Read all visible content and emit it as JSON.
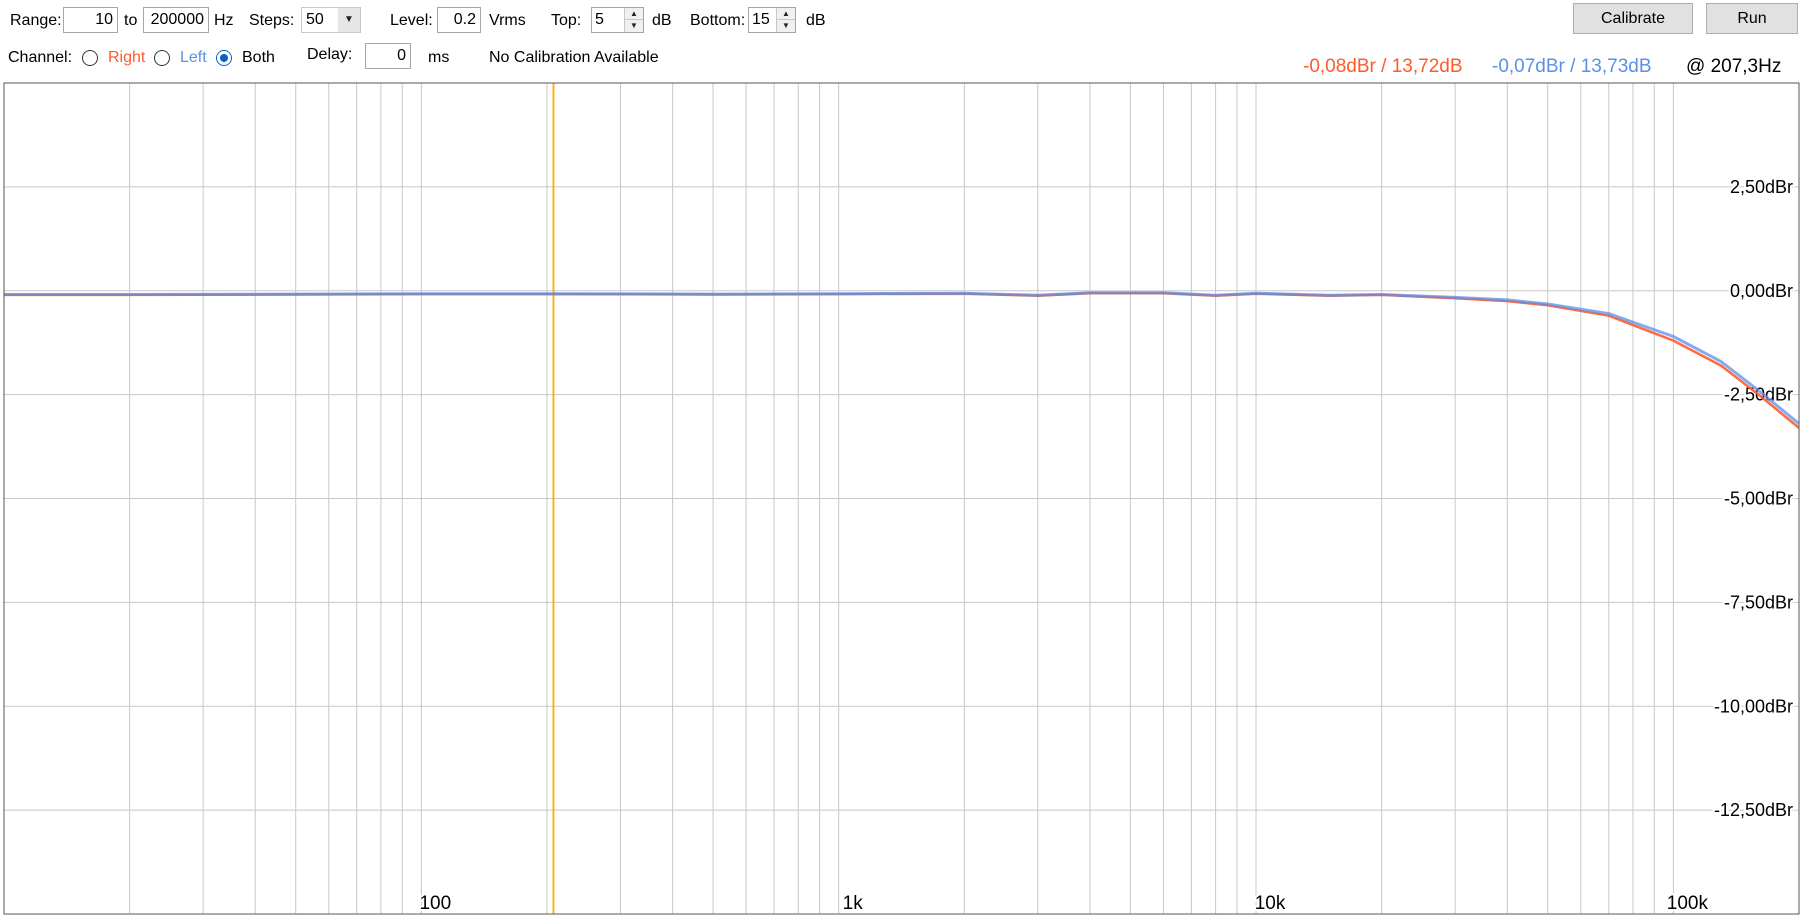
{
  "toolbar": {
    "range_label": "Range:",
    "range_from": "10",
    "range_to_label": "to",
    "range_to": "200000",
    "hz_label": "Hz",
    "steps_label": "Steps:",
    "steps_value": "50",
    "level_label": "Level:",
    "level_value": "0.2",
    "vrms_label": "Vrms",
    "top_label": "Top:",
    "top_value": "5",
    "top_unit": "dB",
    "bottom_label": "Bottom:",
    "bottom_value": "15",
    "bottom_unit": "dB",
    "channel_label": "Channel:",
    "channel_options": [
      "Right",
      "Left",
      "Both"
    ],
    "channel_selected": "Both",
    "delay_label": "Delay:",
    "delay_value": "0",
    "delay_unit": "ms",
    "calibration_status": "No Calibration Available",
    "calibrate_button": "Calibrate",
    "run_button": "Run"
  },
  "readout": {
    "right": "-0,08dBr / 13,72dB",
    "left": "-0,07dBr / 13,73dB",
    "freq": "@ 207,3Hz"
  },
  "colors": {
    "right": "#ff5a2a",
    "left": "#5b8fe8",
    "cursor": "#ffb020",
    "grid": "#c8c8c8"
  },
  "chart_data": {
    "type": "line",
    "x_scale": "log",
    "xlim": [
      10,
      200000
    ],
    "ylim": [
      -15,
      5
    ],
    "y_ticks": [
      2.5,
      0,
      -2.5,
      -5,
      -7.5,
      -10,
      -12.5
    ],
    "y_tick_labels": [
      "2,50dBr",
      "0,00dBr",
      "-2,50dBr",
      "-5,00dBr",
      "-7,50dBr",
      "-10,00dBr",
      "-12,50dBr"
    ],
    "x_ticks": [
      100,
      1000,
      10000,
      100000
    ],
    "x_tick_labels": [
      "100",
      "1k",
      "10k",
      "100k"
    ],
    "cursor_x": 207.3,
    "series": [
      {
        "name": "Right",
        "x": [
          10,
          20,
          50,
          100,
          207.3,
          500,
          1000,
          2000,
          3000,
          4000,
          6000,
          8000,
          10000,
          15000,
          20000,
          30000,
          40000,
          50000,
          70000,
          100000,
          130000,
          160000,
          200000
        ],
        "y": [
          -0.1,
          -0.1,
          -0.09,
          -0.08,
          -0.08,
          -0.09,
          -0.08,
          -0.07,
          -0.12,
          -0.06,
          -0.06,
          -0.12,
          -0.07,
          -0.12,
          -0.1,
          -0.18,
          -0.25,
          -0.35,
          -0.6,
          -1.2,
          -1.8,
          -2.5,
          -3.3
        ]
      },
      {
        "name": "Left",
        "x": [
          10,
          20,
          50,
          100,
          207.3,
          500,
          1000,
          2000,
          3000,
          4000,
          6000,
          8000,
          10000,
          15000,
          20000,
          30000,
          40000,
          50000,
          70000,
          100000,
          130000,
          160000,
          200000
        ],
        "y": [
          -0.09,
          -0.09,
          -0.08,
          -0.07,
          -0.07,
          -0.08,
          -0.07,
          -0.06,
          -0.11,
          -0.05,
          -0.05,
          -0.11,
          -0.06,
          -0.11,
          -0.09,
          -0.16,
          -0.22,
          -0.32,
          -0.55,
          -1.1,
          -1.7,
          -2.4,
          -3.2
        ]
      }
    ]
  }
}
